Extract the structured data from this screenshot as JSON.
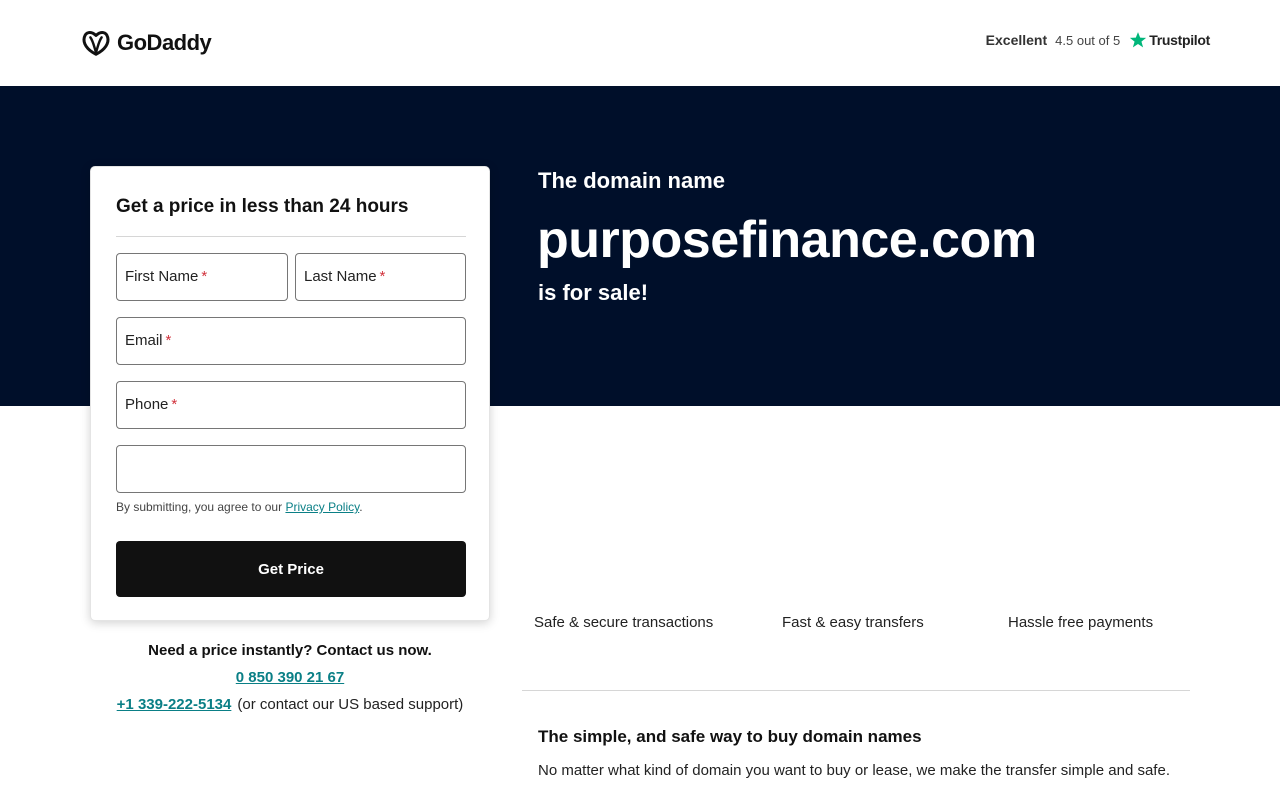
{
  "header": {
    "logo_text": "GoDaddy",
    "trust_rating_label": "Excellent",
    "trust_score": "4.5 out of 5",
    "trust_brand": "Trustpilot",
    "trust_star_color": "#00b67a"
  },
  "hero": {
    "kicker": "The domain name",
    "domain": "purposefinance.com",
    "suffix": "is for sale!",
    "background_color": "#000f2a"
  },
  "form": {
    "title": "Get a price in less than 24 hours",
    "first_name_label": "First Name",
    "last_name_label": "Last Name",
    "email_label": "Email",
    "phone_label": "Phone",
    "required_marker": "*",
    "extra_field_value": "",
    "consent_prefix": "By submitting, you agree to our",
    "consent_link": "Privacy Policy",
    "consent_suffix": ".",
    "submit_label": "Get Price"
  },
  "contact": {
    "heading": "Need a price instantly? Contact us now.",
    "phone_primary": "0 850 390 21 67",
    "phone_us": "+1 339-222-5134",
    "phone_us_note": "(or contact our US based support)"
  },
  "features": [
    {
      "label": "Safe & secure transactions"
    },
    {
      "label": "Fast & easy transfers"
    },
    {
      "label": "Hassle free payments"
    }
  ],
  "info": {
    "title": "The simple, and safe way to buy domain names",
    "body": "No matter what kind of domain you want to buy or lease, we make the transfer simple and safe."
  },
  "colors": {
    "link": "#0a7f86",
    "required": "#d1323c",
    "button": "#111111"
  }
}
